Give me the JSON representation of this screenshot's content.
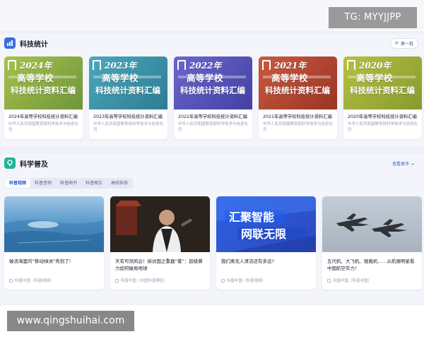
{
  "watermarks": {
    "top_right": "TG: MYYJJPP",
    "bottom_left": "www.qingshuihai.com"
  },
  "stats": {
    "title": "科技统计",
    "action": "换一批",
    "books": [
      {
        "year": "2024年",
        "line1": "高等学校",
        "line2": "科技统计资料汇编",
        "title": "2024年高等学校科技统计资料汇编",
        "subtitle": "中华人民共和国教育部科学技术与信息化司",
        "color": "#8fae3e"
      },
      {
        "year": "2023年",
        "line1": "高等学校",
        "line2": "科技统计资料汇编",
        "title": "2023年高等学校科技统计资料汇编",
        "subtitle": "中华人民共和国教育部科学技术与信息化司",
        "color": "#3a93a8"
      },
      {
        "year": "2022年",
        "line1": "高等学校",
        "line2": "科技统计资料汇编",
        "title": "2022年高等学校科技统计资料汇编",
        "subtitle": "中华人民共和国教育部科学技术与信息化司",
        "color": "#5553b8"
      },
      {
        "year": "2021年",
        "line1": "高等学校",
        "line2": "科技统计资料汇编",
        "title": "2021年高等学校科技统计资料汇编",
        "subtitle": "中华人民共和国教育部科学技术与信息化司",
        "color": "#b8452f"
      },
      {
        "year": "2020年",
        "line1": "高等学校",
        "line2": "科技统计资料汇编",
        "title": "2020年高等学校科技统计资料汇编",
        "subtitle": "中华人民共和国教育部科学技术与信息化司",
        "color": "#9cab3a"
      }
    ]
  },
  "popular": {
    "title": "科学普及",
    "action": "查看更多 →",
    "tabs": [
      "科普视频",
      "科普音频",
      "科普图书",
      "科普图文",
      "高校科协"
    ],
    "active_tab": 0,
    "videos": [
      {
        "title": "破浪海里的“移动绿洲”秀到了!",
        "source": "科普中国（科普视频）"
      },
      {
        "title": "天有可测风云！探访国之重器“寰”：超级算力如何破局地球",
        "source": "科普中国（中国科普博览）"
      },
      {
        "title": "我们离无人清洁还有多远?",
        "source": "科普中国（科普视频）"
      },
      {
        "title": "五代机、大飞机、舰载机……从航展明星看中国航空实力!",
        "source": "科普中国（科普中国）"
      }
    ]
  }
}
